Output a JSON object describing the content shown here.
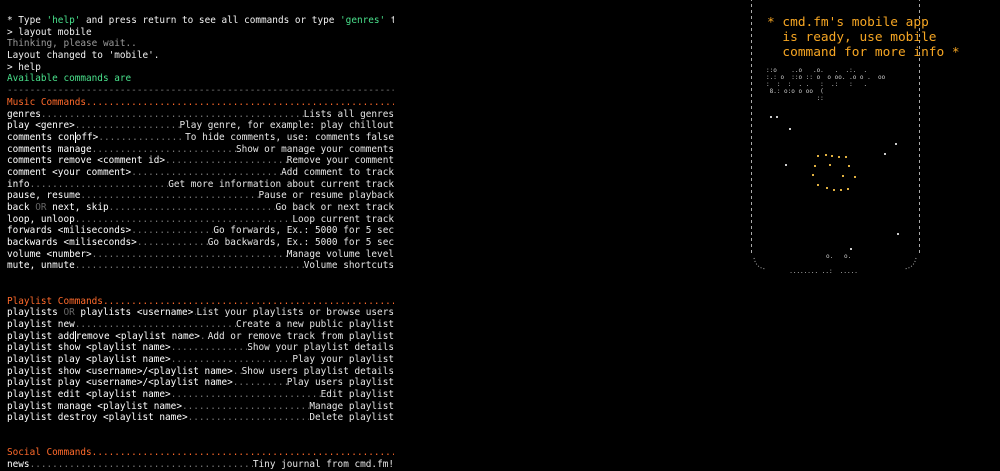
{
  "intro": {
    "line1_a": "* Type ",
    "line1_help": "'help'",
    "line1_b": " and press return to see all commands or type ",
    "line1_genres": "'genres'",
    "line1_c": " to explore:",
    "prompt1": "> layout mobile",
    "thinking": "Thinking, please wait..",
    "layout_changed": "Layout changed to 'mobile'.",
    "prompt2": "> help",
    "available": "Available commands are",
    "rule": "----------------------------------------------------------------------------------------------"
  },
  "music": {
    "title": "Music Commands",
    "rows": [
      {
        "cmd": "genres",
        "desc": "Lists all genres"
      },
      {
        "cmd": "play <genre>",
        "desc": "Play genre, for example: play chillout"
      },
      {
        "cmd_a": "comments con",
        "cmd_b": "off>",
        "cmd": "comments con|off>",
        "desc": "To hide comments, use: comments false"
      },
      {
        "cmd": "comments manage",
        "desc": "Show or manage your comments"
      },
      {
        "cmd": "comments remove <comment id>",
        "desc": "Remove your comment"
      },
      {
        "cmd": "comment <your comment>",
        "desc": "Add comment to track"
      },
      {
        "cmd": "info",
        "desc": "Get more information about current track"
      },
      {
        "cmd": "pause, resume",
        "desc": "Pause or resume playback"
      },
      {
        "cmd_a": "back ",
        "cmd_or": "OR",
        "cmd_b": " next, skip",
        "desc": "Go back or next track"
      },
      {
        "cmd": "loop, unloop",
        "desc": "Loop current track"
      },
      {
        "cmd": "forwards <miliseconds>",
        "desc": "Go forwards, Ex.: 5000 for 5 sec"
      },
      {
        "cmd": "backwards <miliseconds>",
        "desc": "Go backwards, Ex.: 5000 for 5 sec"
      },
      {
        "cmd": "volume <number>",
        "desc": "Manage volume level"
      },
      {
        "cmd": "mute, unmute",
        "desc": "Volume shortcuts"
      }
    ]
  },
  "playlist": {
    "title": "Playlist Commands",
    "rows": [
      {
        "cmd_a": "playlists ",
        "cmd_or": "OR",
        "cmd_b": " playlists <username>",
        "desc": "List your playlists or browse users"
      },
      {
        "cmd": "playlist new",
        "desc": "Create a new public playlist"
      },
      {
        "cmd_a": "playlist add",
        "cmd_b": "remove <playlist name>",
        "desc": "Add or remove track from playlist"
      },
      {
        "cmd": "playlist show <playlist name>",
        "desc": "Show your playlist details"
      },
      {
        "cmd": "playlist play <playlist name>",
        "desc": "Play your playlist"
      },
      {
        "cmd": "playlist show <username>/<playlist name>",
        "desc": "Show users playlist details"
      },
      {
        "cmd": "playlist play <username>/<playlist name>",
        "desc": "Play users playlist"
      },
      {
        "cmd": "playlist edit <playlist name>",
        "desc": "Edit playlist"
      },
      {
        "cmd": "playlist manage <playlist name>",
        "desc": "Manage playlist"
      },
      {
        "cmd": "playlist destroy <playlist name>",
        "desc": "Delete playlist"
      }
    ]
  },
  "social": {
    "title": "Social Commands",
    "rows": [
      {
        "cmd": "news",
        "desc": "Tiny journal from cmd.fm!"
      }
    ]
  },
  "promo": {
    "text": "* cmd.fm's mobile app\n  is ready, use mobile\n  command for more info *"
  },
  "art": {
    "top_block": "::o    ..o   .o.   .  .:.  .\n:.: o  ::o :: o  o oo. .o o .  oo\n:  :  :  . .   :  .:   :   .\n 8.: o:o o oo  (\n              ::",
    "bottom_block": "  ........ ..:  .....",
    "bottom_marks": "o.   o."
  },
  "colors": {
    "accent_orange": "#ff6a2b",
    "highlight_green": "#49e08b",
    "promo_yellow": "#f6a623",
    "background": "#000000"
  }
}
